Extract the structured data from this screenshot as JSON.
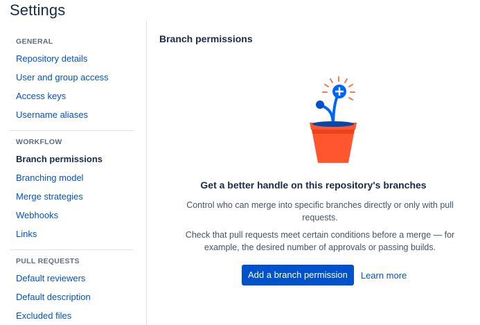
{
  "page": {
    "title": "Settings"
  },
  "sidebar": {
    "sections": [
      {
        "title": "GENERAL",
        "items": [
          "Repository details",
          "User and group access",
          "Access keys",
          "Username aliases"
        ]
      },
      {
        "title": "WORKFLOW",
        "items": [
          "Branch permissions",
          "Branching model",
          "Merge strategies",
          "Webhooks",
          "Links"
        ]
      },
      {
        "title": "PULL REQUESTS",
        "items": [
          "Default reviewers",
          "Default description",
          "Excluded files"
        ]
      }
    ],
    "active_item": "Branch permissions"
  },
  "main": {
    "heading": "Branch permissions",
    "illustration": "flower-pot-with-branch-icon",
    "empty_title": "Get a better handle on this repository's branches",
    "description_1": "Control who can merge into specific branches directly or only with pull requests.",
    "description_2": "Check that pull requests meet certain conditions before a merge — for example, the desired number of approvals or passing builds.",
    "primary_button": "Add a branch permission",
    "learn_more": "Learn more"
  },
  "colors": {
    "link": "#0052cc",
    "text": "#172b4d",
    "muted": "#5e6c84",
    "pot": "#ff5630",
    "accent": "#0065ff"
  }
}
